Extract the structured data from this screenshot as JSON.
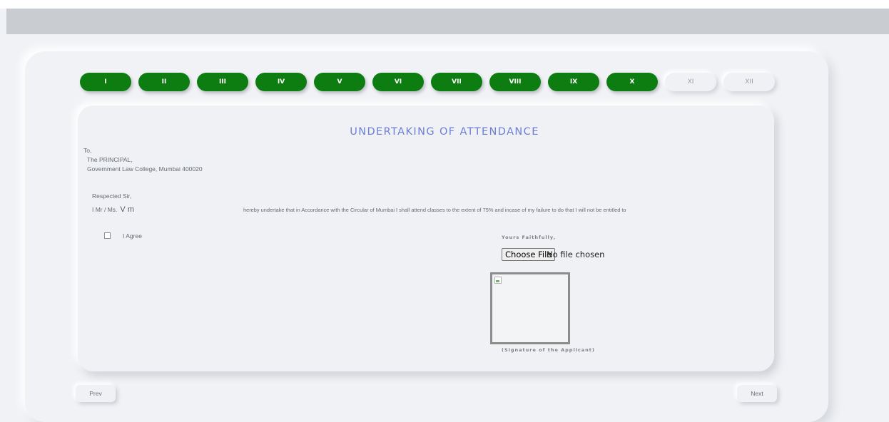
{
  "steps": [
    "I",
    "II",
    "III",
    "IV",
    "V",
    "VI",
    "VII",
    "VIII",
    "IX",
    "X",
    "XI",
    "XII"
  ],
  "completed_steps": 10,
  "colors": {
    "completed_tab": "#0d7d12",
    "title": "#6d7fd6"
  },
  "form": {
    "title": "UNDERTAKING OF ATTENDANCE",
    "address_to": "To,",
    "address_line1": "The PRINCIPAL,",
    "address_line2": "Government Law College, Mumbai 400020",
    "salutation": "Respected Sir,",
    "name_prefix": "I Mr / Ms.",
    "applicant_name": "V m",
    "undertaking_text": "hereby undertake that in Accordance with the Circular of Mumbai I shall attend classes to the extent of 75% and incase of my failure to do that I will not be entitled to",
    "agree_label": "I Agree",
    "agree_checked": false,
    "yours_faithfully": "Yours Faithfully,",
    "file_button": "Choose File",
    "file_status": "No file chosen",
    "signature_caption": "(Signature of the Applicant)"
  },
  "nav": {
    "prev": "Prev",
    "next": "Next"
  }
}
